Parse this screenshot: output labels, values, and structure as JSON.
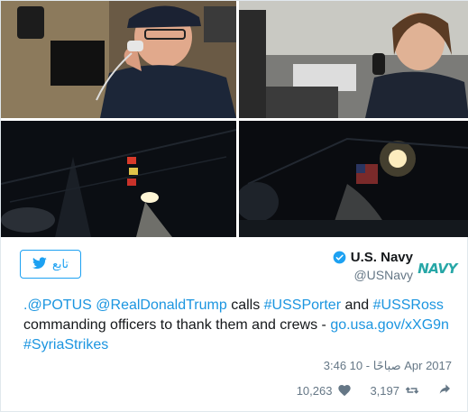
{
  "follow": {
    "label": "تابع"
  },
  "user": {
    "display_name": "U.S. Navy",
    "handle": "@USNavy",
    "avatar_text": "NAVY"
  },
  "tweet": {
    "mention1": ".@POTUS",
    "mention2": "@RealDonaldTrump",
    "t1": " calls ",
    "hashtag1": "#USSPorter",
    "t2": " and ",
    "hashtag2": "#USSRoss",
    "t3": " commanding officers to thank them and crews - ",
    "link": "go.usa.gov/xXG9n",
    "hashtag3": "#SyriaStrikes"
  },
  "timestamp": "3:46 صباحًا - 10 Apr 2017",
  "stats": {
    "likes": "10,263",
    "retweets": "3,197"
  },
  "colors": {
    "accent": "#1da1f2",
    "link": "#1b95e0",
    "muted": "#657786",
    "avatar": "#27a7a7"
  },
  "icons": [
    "twitter-bird-icon",
    "verified-badge-icon",
    "heart-icon",
    "retweet-icon",
    "reply-icon"
  ]
}
